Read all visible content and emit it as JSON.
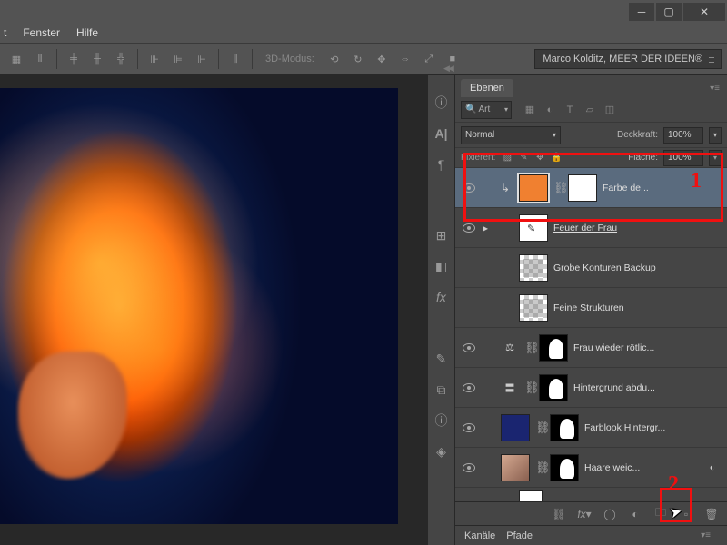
{
  "menu": {
    "items": [
      "t",
      "Fenster",
      "Hilfe"
    ]
  },
  "toolbar": {
    "mode_label": "3D-Modus:",
    "user_dropdown": "Marco Kolditz, MEER DER IDEEN®"
  },
  "panel": {
    "tab_active": "Ebenen",
    "filter_search_placeholder": "Art",
    "blend_mode": "Normal",
    "opacity_label": "Deckkraft:",
    "opacity_value": "100%",
    "lock_label": "Fixieren:",
    "fill_label": "Fläche:",
    "fill_value": "100%"
  },
  "layers": [
    {
      "name": "Farbe de...",
      "selected": true,
      "visible": true,
      "clipped": true,
      "thumb": "orange",
      "mask": "white"
    },
    {
      "name": "Feuer der Frau",
      "visible": true,
      "underline": true,
      "thumb": "white",
      "group": true
    },
    {
      "name": "Grobe Konturen Backup",
      "visible": false,
      "thumb": "checker"
    },
    {
      "name": "Feine Strukturen",
      "visible": false,
      "thumb": "checker"
    },
    {
      "name": "Frau wieder rötlic...",
      "visible": true,
      "adj": "balance",
      "mask": "mask-sil"
    },
    {
      "name": "Hintergrund abdu...",
      "visible": true,
      "adj": "levels",
      "mask": "mask-sil"
    },
    {
      "name": "Farblook Hintergr...",
      "visible": true,
      "thumb": "darkblue",
      "mask": "mask-sil"
    },
    {
      "name": "Haare weic...",
      "visible": true,
      "thumb": "photo",
      "mask": "mask-sil",
      "smart": true
    }
  ],
  "bottom_tabs": [
    "Kanäle",
    "Pfade"
  ],
  "annotations": {
    "n1": "1",
    "n2": "2"
  }
}
